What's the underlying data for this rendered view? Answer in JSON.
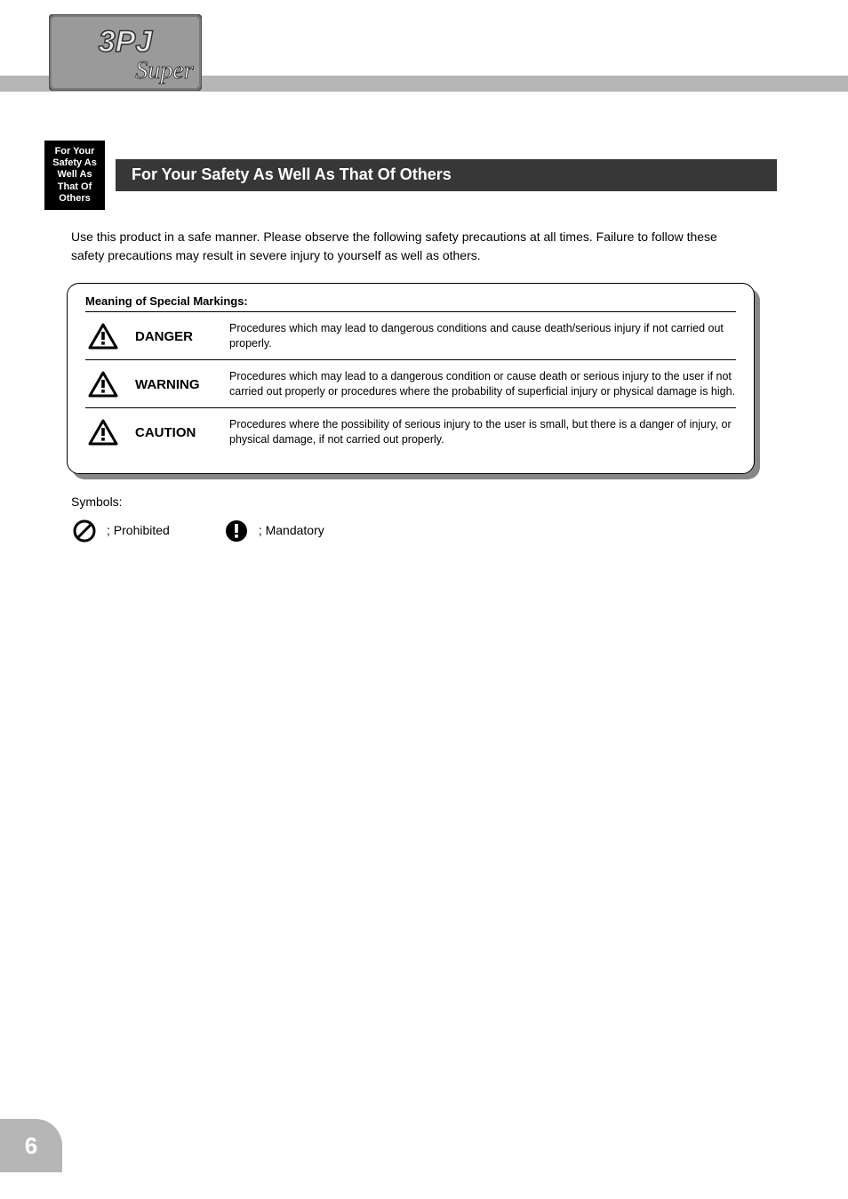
{
  "header": {
    "logo_top": "3PJ",
    "logo_sub": "Super"
  },
  "sidebar_tab": "For Your Safety As Well As That Of Others",
  "section_title": "For Your Safety As Well As That Of Others",
  "intro": "Use this product in a safe manner. Please observe the following safety precautions at all times. Failure to follow these safety precautions may result in severe injury to yourself as well as others.",
  "safety_box": {
    "header": "Meaning of Special Markings:",
    "rows": [
      {
        "label": "DANGER",
        "desc": "Procedures which may lead to dangerous conditions and cause death/serious injury if not carried out properly."
      },
      {
        "label": "WARNING",
        "desc": "Procedures which may lead to a dangerous condition or cause death or serious injury to the user if not carried out properly or procedures where the probability of superficial injury or physical damage is high."
      },
      {
        "label": "CAUTION",
        "desc": "Procedures where the possibility of serious injury to the user is small, but there is a danger of injury, or physical damage, if not carried out properly."
      }
    ]
  },
  "legend": {
    "intro": "Symbols:",
    "prohibited": "; Prohibited",
    "mandatory": "; Mandatory"
  },
  "page_number": "6"
}
